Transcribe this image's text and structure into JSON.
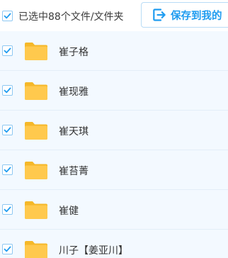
{
  "header": {
    "select_all_checked": true,
    "selection_text": "已选中88个文件/文件夹",
    "save_button_label": "保存到我的",
    "save_icon": "save-export-icon"
  },
  "files": [
    {
      "name": "崔子格",
      "type": "folder",
      "checked": true
    },
    {
      "name": "崔现雅",
      "type": "folder",
      "checked": true
    },
    {
      "name": "崔天琪",
      "type": "folder",
      "checked": true
    },
    {
      "name": "崔苔菁",
      "type": "folder",
      "checked": true
    },
    {
      "name": "崔健",
      "type": "folder",
      "checked": true
    },
    {
      "name": "川子【姜亚川】",
      "type": "folder",
      "checked": true
    }
  ],
  "colors": {
    "accent": "#1f9cf0",
    "folder": "#ffc94d",
    "list_background": "#f3f9ff",
    "checkbox_border": "#8fc8f2"
  }
}
